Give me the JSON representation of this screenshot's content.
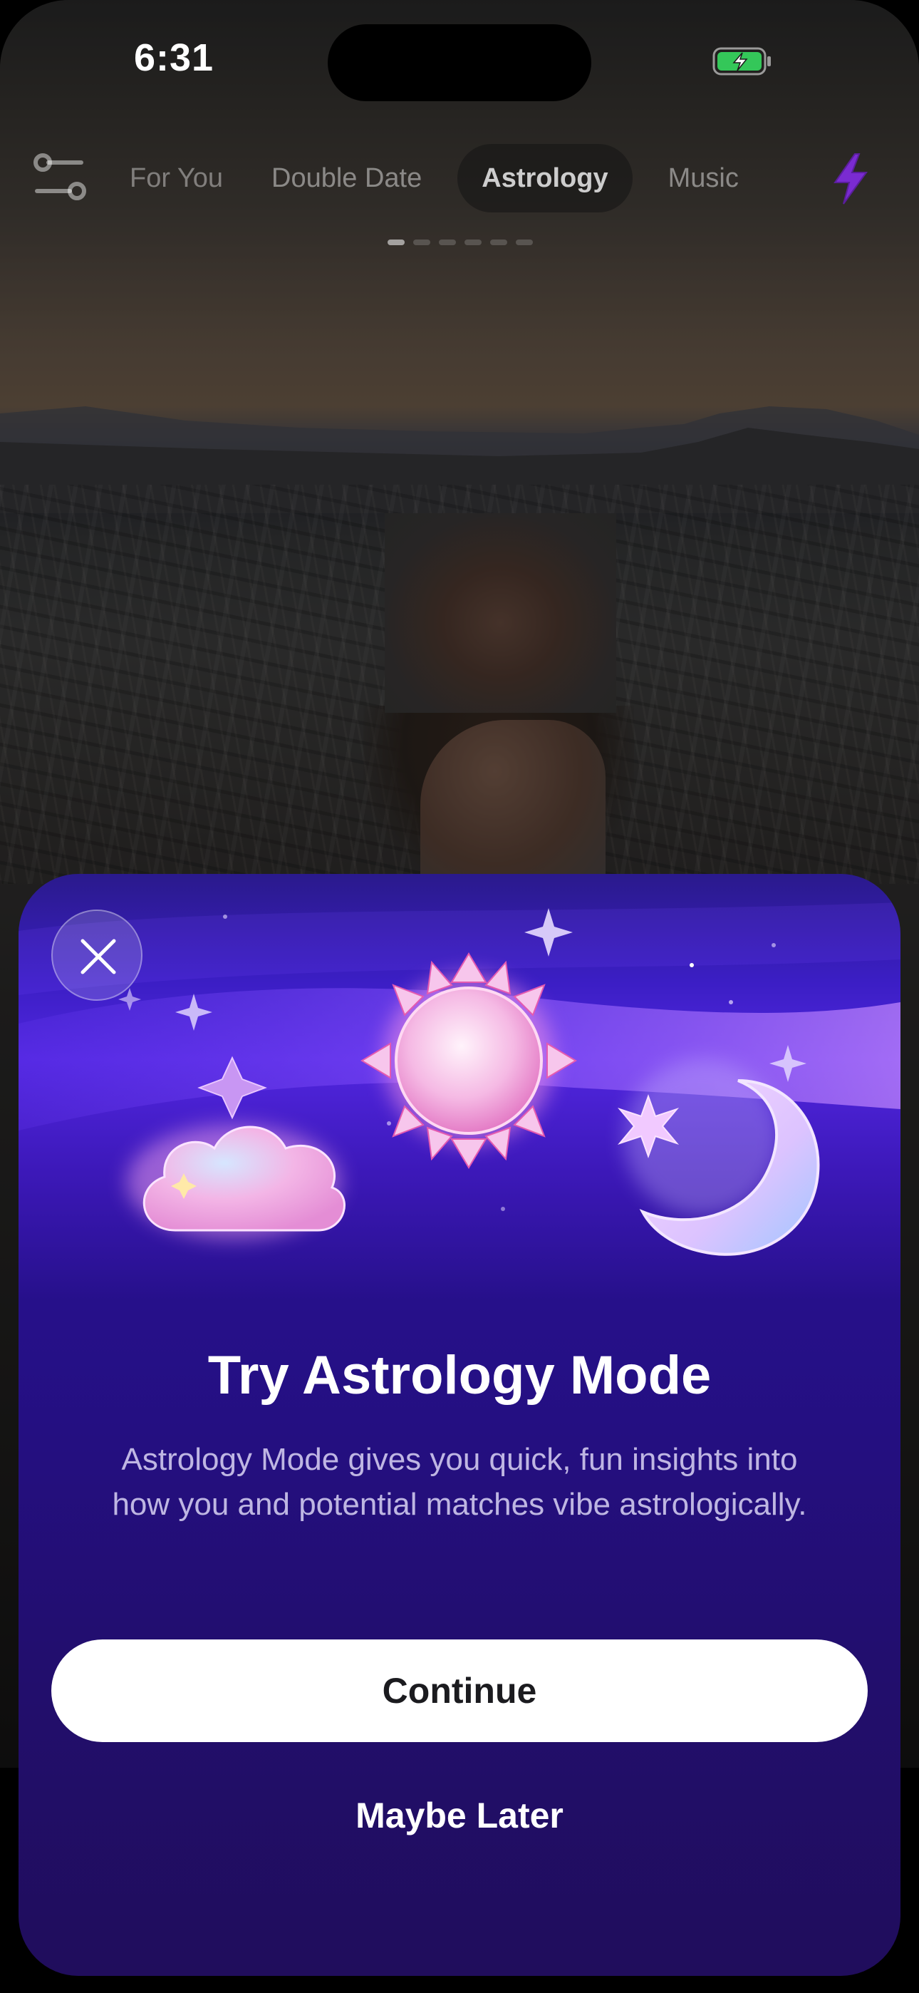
{
  "status_bar": {
    "time": "6:31",
    "battery_icon": "battery-charging-icon",
    "battery_color": "#34c759"
  },
  "top_nav": {
    "filter_icon": "sliders-icon",
    "tabs": [
      {
        "label": "For You",
        "active": false
      },
      {
        "label": "Double Date",
        "active": false
      },
      {
        "label": "Astrology",
        "active": true
      },
      {
        "label": "Music",
        "active": false
      }
    ],
    "boost_icon": "lightning-bolt-icon",
    "boost_color": "#7a2bd1",
    "page_indicator": {
      "count": 6,
      "active_index": 0
    }
  },
  "modal": {
    "close_icon": "close-icon",
    "illustration_icons": [
      "cloud-icon",
      "sun-icon",
      "moon-icon",
      "star-icon",
      "sparkle-icon"
    ],
    "title": "Try Astrology Mode",
    "description": "Astrology Mode gives you quick, fun insights into how you and potential matches vibe astrologically.",
    "primary_button": "Continue",
    "secondary_button": "Maybe Later",
    "accent_colors": {
      "top": "#5126e0",
      "bottom": "#200d5c"
    }
  }
}
